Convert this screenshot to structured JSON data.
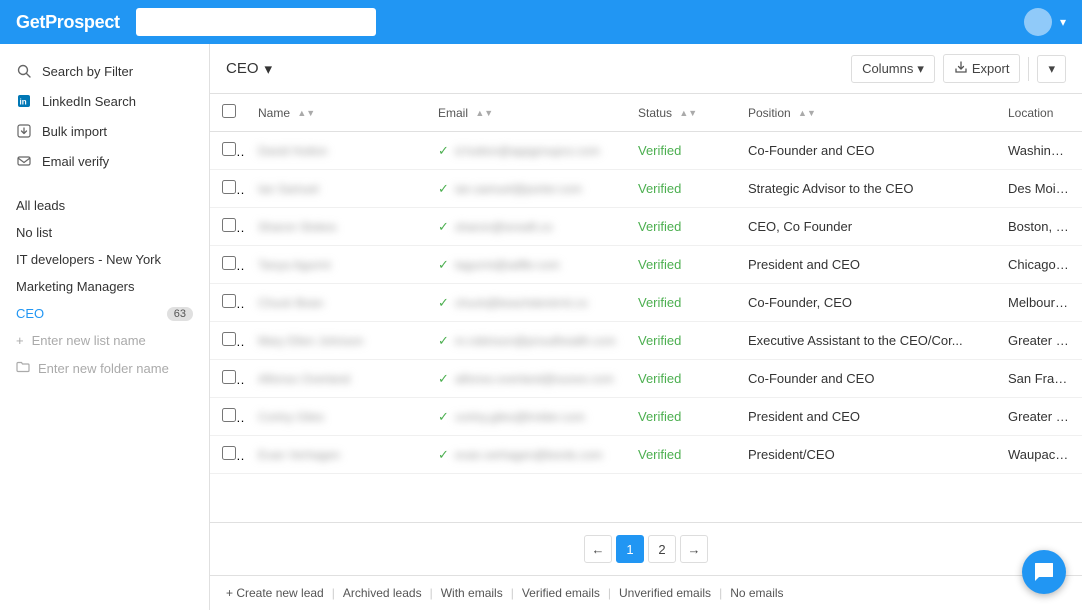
{
  "app": {
    "name": "GetProspect",
    "search_placeholder": ""
  },
  "sidebar": {
    "items": [
      {
        "id": "search-filter",
        "label": "Search by Filter",
        "icon": "🔍"
      },
      {
        "id": "linkedin-search",
        "label": "LinkedIn Search",
        "icon": "🔗"
      },
      {
        "id": "bulk-import",
        "label": "Bulk import",
        "icon": "📥"
      },
      {
        "id": "email-verify",
        "label": "Email verify",
        "icon": "✉️"
      }
    ],
    "lists": {
      "all_leads": "All leads",
      "no_list": "No list",
      "it_developers": "IT developers - New York",
      "marketing_managers": "Marketing Managers",
      "ceo": "CEO",
      "ceo_count": "63"
    },
    "add_list_placeholder": "Enter new list name",
    "add_folder_placeholder": "Enter new folder name"
  },
  "header": {
    "list_name": "CEO",
    "columns_label": "Columns",
    "export_label": "Export"
  },
  "table": {
    "columns": [
      {
        "id": "name",
        "label": "Name"
      },
      {
        "id": "email",
        "label": "Email"
      },
      {
        "id": "status",
        "label": "Status"
      },
      {
        "id": "position",
        "label": "Position"
      },
      {
        "id": "location",
        "label": "Location"
      }
    ],
    "rows": [
      {
        "name": "David Hutton",
        "email": "d.hutton@appgroupco.com",
        "status": "Verified",
        "position": "Co-Founder and CEO",
        "location": "Washington D.C. Metro Area"
      },
      {
        "name": "Ian Samuel",
        "email": "ian.samuel@porter.com",
        "status": "Verified",
        "position": "Strategic Advisor to the CEO",
        "location": "Des Moines, Iowa Area"
      },
      {
        "name": "Sharon Stokes",
        "email": "sharon@ixreaft.co",
        "status": "Verified",
        "position": "CEO, Co Founder",
        "location": "Boston, Massachusetts"
      },
      {
        "name": "Tanya Agurmi",
        "email": "tagurmi@adfbr.com",
        "status": "Verified",
        "position": "President and CEO",
        "location": "Chicago, Illinois"
      },
      {
        "name": "Chuck Bean",
        "email": "chuck@beachdentrmt.co",
        "status": "Verified",
        "position": "Co-Founder, CEO",
        "location": "Melbourne Beach, Florida"
      },
      {
        "name": "Mary Ellen Johnson",
        "email": "m.robinson@proudhealth.com",
        "status": "Verified",
        "position": "Executive Assistant to the CEO/Cor...",
        "location": "Greater New York City Area"
      },
      {
        "name": "Alfonso Overland",
        "email": "alfonso.overland@suooo.com",
        "status": "Verified",
        "position": "Co-Founder and CEO",
        "location": "San Francisco, California"
      },
      {
        "name": "Cortny Giles",
        "email": "cortny.giles@lrvlder.com",
        "status": "Verified",
        "position": "President and CEO",
        "location": "Greater New York City Area"
      },
      {
        "name": "Evan Verhagen",
        "email": "evan.verhagen@bords.com",
        "status": "Verified",
        "position": "President/CEO",
        "location": "Waupaca, Wisconsin"
      }
    ]
  },
  "pagination": {
    "prev_label": "←",
    "next_label": "→",
    "pages": [
      "1",
      "2"
    ],
    "active_page": "1"
  },
  "footer": {
    "create_lead": "+ Create new lead",
    "archived_leads": "Archived leads",
    "with_emails": "With emails",
    "verified_emails": "Verified emails",
    "unverified_emails": "Unverified emails",
    "no_emails": "No emails"
  },
  "colors": {
    "primary": "#2196F3",
    "verified_green": "#4CAF50"
  }
}
